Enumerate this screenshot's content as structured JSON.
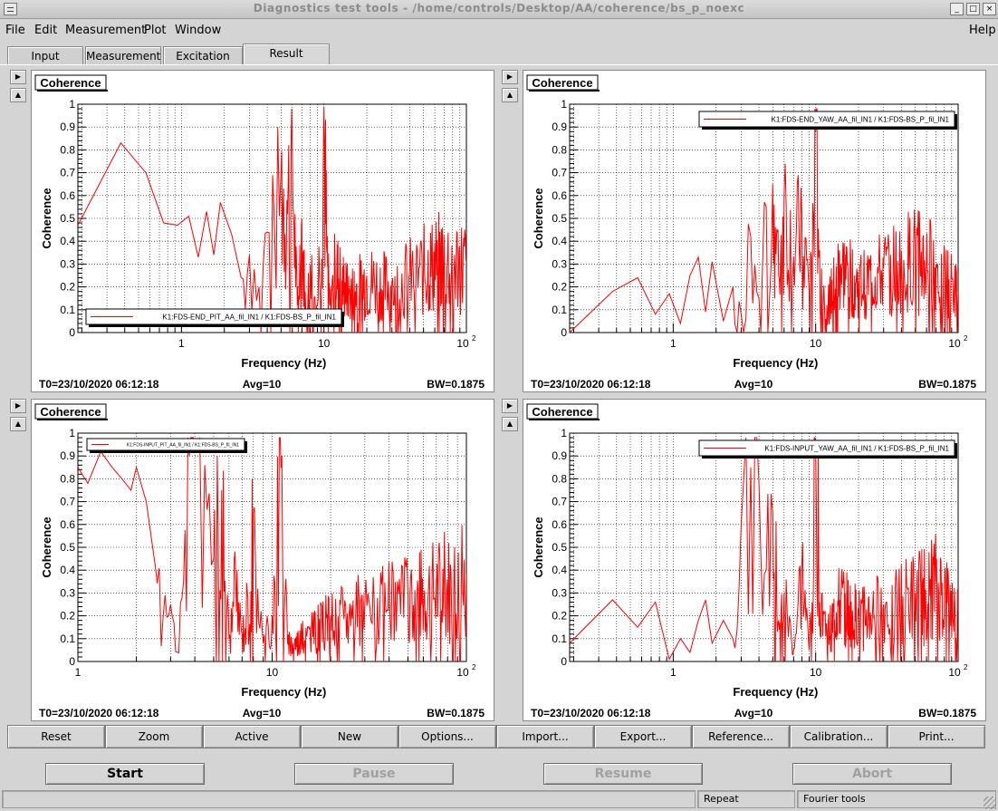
{
  "window": {
    "title": "Diagnostics test tools - /home/controls/Desktop/AA/coherence/bs_p_noexc",
    "controls": [
      "_",
      "□",
      "×"
    ]
  },
  "menubar": {
    "file": "File",
    "edit": "Edit",
    "measurement": "Measurement",
    "plot": "Plot",
    "window": "Window",
    "help": "Help"
  },
  "tabs": [
    "Input",
    "Measurement",
    "Excitation",
    "Result"
  ],
  "active_tab": "Result",
  "trace_color": "#ff0000",
  "panels": [
    {
      "title": "Coherence",
      "ylabel": "Coherence",
      "xlabel": "Frequency (Hz)",
      "legend": "K1:FDS-END_PIT_AA_fil_IN1 / K1:FDS-BS_P_fil_IN1",
      "legend_pos": "bottom",
      "legend_size": "normal",
      "t0": "T0=23/10/2020 06:12:18",
      "avg": "Avg=10",
      "bw": "BW=0.1875",
      "x_tick_labels": [
        "1",
        "10"
      ],
      "x_decade_label": "2",
      "x_decade_base": "10",
      "yticks": [
        "0",
        "0.1",
        "0.2",
        "0.3",
        "0.4",
        "0.5",
        "0.6",
        "0.7",
        "0.8",
        "0.9",
        "1"
      ]
    },
    {
      "title": "Coherence",
      "ylabel": "Coherence",
      "xlabel": "Frequency (Hz)",
      "legend": "K1:FDS-END_YAW_AA_fil_IN1 / K1:FDS-BS_P_fil_IN1",
      "legend_pos": "top-right",
      "legend_size": "normal",
      "t0": "T0=23/10/2020 06:12:18",
      "avg": "Avg=10",
      "bw": "BW=0.1875",
      "x_tick_labels": [
        "1",
        "10"
      ],
      "x_decade_label": "2",
      "x_decade_base": "10",
      "yticks": [
        "0",
        "0.1",
        "0.2",
        "0.3",
        "0.4",
        "0.5",
        "0.6",
        "0.7",
        "0.8",
        "0.9",
        "1"
      ]
    },
    {
      "title": "Coherence",
      "ylabel": "Coherence",
      "xlabel": "Frequency (Hz)",
      "legend": "K1:FDS-INPUT_PIT_AA_fil_IN1 / K1:FDS-BS_P_fil_IN1",
      "legend_pos": "top-left",
      "legend_size": "small",
      "t0": "T0=23/10/2020 06:12:18",
      "avg": "Avg=10",
      "bw": "BW=0.1875",
      "x_tick_labels": [
        "1",
        "10"
      ],
      "x_decade_label": "2",
      "x_decade_base": "10",
      "yticks": [
        "0",
        "0.1",
        "0.2",
        "0.3",
        "0.4",
        "0.5",
        "0.6",
        "0.7",
        "0.8",
        "0.9",
        "1"
      ]
    },
    {
      "title": "Coherence",
      "ylabel": "Coherence",
      "xlabel": "Frequency (Hz)",
      "legend": "K1:FDS-INPUT_YAW_AA_fil_IN1 / K1:FDS-BS_P_fil_IN1",
      "legend_pos": "top-right",
      "legend_size": "normal",
      "t0": "T0=23/10/2020 06:12:18",
      "avg": "Avg=10",
      "bw": "BW=0.1875",
      "x_tick_labels": [
        "1",
        "10"
      ],
      "x_decade_label": "2",
      "x_decade_base": "10",
      "yticks": [
        "0",
        "0.1",
        "0.2",
        "0.3",
        "0.4",
        "0.5",
        "0.6",
        "0.7",
        "0.8",
        "0.9",
        "1"
      ]
    }
  ],
  "panel_buttons": [
    "Reset",
    "Zoom",
    "Active",
    "New",
    "Options...",
    "Import...",
    "Export...",
    "Reference...",
    "Calibration...",
    "Print..."
  ],
  "control_buttons": {
    "start": "Start",
    "pause": "Pause",
    "resume": "Resume",
    "abort": "Abort"
  },
  "status": {
    "main": "",
    "repeat": "Repeat",
    "fourier": "Fourier tools"
  },
  "chart_data": [
    {
      "type": "line",
      "xscale": "log",
      "xlim": [
        0.1875,
        100
      ],
      "ylim": [
        0,
        1
      ],
      "grid": true,
      "x": [
        0.1875,
        0.375,
        0.5625,
        0.75,
        0.9375,
        1.125,
        1.3125,
        1.5,
        1.6875,
        1.875,
        2.25,
        2.625,
        3.0,
        3.5,
        4.0,
        4.5,
        5.0,
        5.5,
        6.0,
        6.5,
        7.0,
        7.5,
        8.0,
        9.0,
        10.0,
        10.5,
        11.0,
        12.0,
        15.0,
        20.0,
        30.0,
        50.0,
        70.0,
        100.0
      ],
      "y": [
        0.47,
        0.83,
        0.7,
        0.48,
        0.47,
        0.51,
        0.33,
        0.53,
        0.34,
        0.57,
        0.43,
        0.24,
        0.34,
        0.2,
        0.44,
        0.46,
        0.71,
        0.58,
        0.79,
        0.12,
        0.5,
        0.05,
        0.3,
        0.12,
        0.99,
        0.35,
        0.12,
        0.3,
        0.18,
        0.25,
        0.22,
        0.3,
        0.35,
        0.32
      ]
    },
    {
      "type": "line",
      "xscale": "log",
      "xlim": [
        0.1875,
        100
      ],
      "ylim": [
        0,
        1
      ],
      "grid": true,
      "x": [
        0.1875,
        0.375,
        0.5625,
        0.75,
        0.9375,
        1.125,
        1.3125,
        1.5,
        1.6875,
        1.875,
        2.25,
        2.625,
        3.0,
        3.5,
        4.0,
        4.5,
        5.0,
        5.5,
        6.0,
        7.0,
        8.0,
        9.0,
        10.0,
        11.0,
        12.0,
        15.0,
        20.0,
        30.0,
        50.0,
        70.0,
        100.0
      ],
      "y": [
        0.0,
        0.18,
        0.24,
        0.08,
        0.17,
        0.04,
        0.25,
        0.33,
        0.09,
        0.31,
        0.05,
        0.2,
        0.08,
        0.42,
        0.15,
        0.55,
        0.65,
        0.25,
        0.6,
        0.33,
        0.52,
        0.18,
        0.88,
        0.28,
        0.12,
        0.3,
        0.22,
        0.28,
        0.35,
        0.3,
        0.18
      ]
    },
    {
      "type": "line",
      "xscale": "log",
      "xlim": [
        1,
        100
      ],
      "ylim": [
        0,
        1
      ],
      "grid": true,
      "x": [
        1.0,
        1.125,
        1.3125,
        1.5,
        1.6875,
        1.875,
        2.0,
        2.25,
        2.5,
        2.75,
        3.0,
        3.25,
        3.5,
        3.75,
        4.0,
        4.5,
        5.0,
        5.5,
        6.0,
        6.5,
        7.0,
        7.5,
        8.0,
        9.0,
        10.0,
        11.0,
        12.0,
        15.0,
        20.0,
        30.0,
        50.0,
        70.0,
        100.0
      ],
      "y": [
        0.85,
        0.78,
        0.92,
        0.85,
        0.8,
        0.75,
        0.85,
        0.7,
        0.42,
        0.2,
        0.25,
        0.04,
        0.35,
        0.9,
        0.96,
        0.86,
        0.45,
        0.75,
        0.1,
        0.35,
        0.12,
        0.28,
        0.65,
        0.08,
        0.2,
        0.98,
        0.08,
        0.12,
        0.2,
        0.25,
        0.3,
        0.35,
        0.38
      ]
    },
    {
      "type": "line",
      "xscale": "log",
      "xlim": [
        0.1875,
        100
      ],
      "ylim": [
        0,
        1
      ],
      "grid": true,
      "x": [
        0.1875,
        0.375,
        0.5625,
        0.75,
        0.9375,
        1.125,
        1.3125,
        1.5,
        1.6875,
        1.875,
        2.25,
        2.625,
        3.0,
        3.5,
        4.0,
        4.5,
        5.0,
        5.5,
        6.0,
        7.0,
        8.0,
        9.0,
        10.0,
        11.0,
        12.0,
        15.0,
        20.0,
        30.0,
        50.0,
        70.0,
        100.0
      ],
      "y": [
        0.08,
        0.27,
        0.15,
        0.26,
        0.01,
        0.1,
        0.04,
        0.18,
        0.27,
        0.08,
        0.18,
        0.1,
        0.6,
        0.85,
        0.78,
        0.4,
        0.65,
        0.18,
        0.3,
        0.05,
        0.42,
        0.05,
        0.92,
        0.3,
        0.12,
        0.28,
        0.2,
        0.25,
        0.3,
        0.35,
        0.22
      ]
    }
  ]
}
